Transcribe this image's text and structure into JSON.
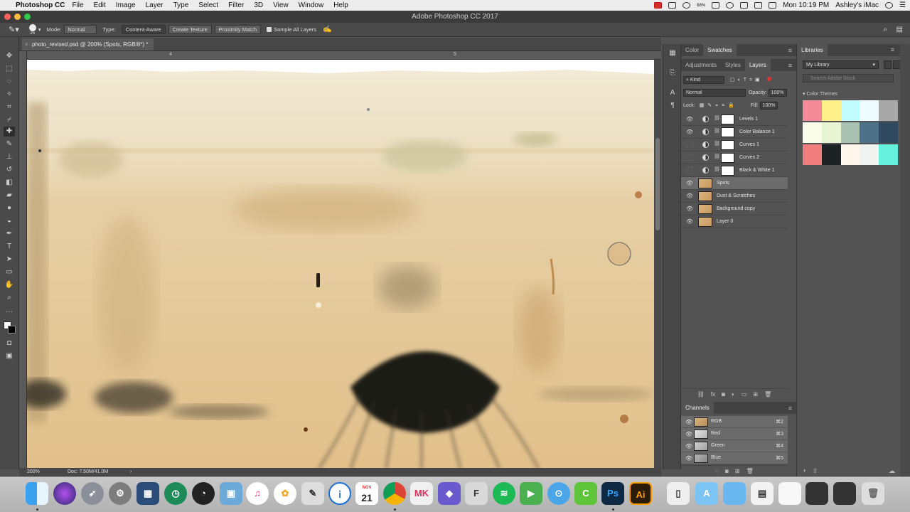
{
  "menubar": {
    "app_name": "Photoshop CC",
    "items": [
      "File",
      "Edit",
      "Image",
      "Layer",
      "Type",
      "Select",
      "Filter",
      "3D",
      "View",
      "Window",
      "Help"
    ],
    "battery_text": "68%",
    "clock": "Mon 10:19 PM",
    "user": "Ashley's iMac"
  },
  "window": {
    "title": "Adobe Photoshop CC 2017"
  },
  "options_bar": {
    "brush_size": "25",
    "mode_label": "Mode:",
    "mode_value": "Normal",
    "type_label": "Type:",
    "type_buttons": [
      "Content-Aware",
      "Create Texture",
      "Proximity Match"
    ],
    "sample_all_layers": "Sample All Layers"
  },
  "document": {
    "tab_title": "photo_revised.psd @ 200% (Spots, RGB/8*) *",
    "ruler_marks": [
      "4",
      "5"
    ],
    "zoom": "200%",
    "doc_size": "Doc: 7.50M/41.0M"
  },
  "panels": {
    "color_tabs": [
      "Color",
      "Swatches"
    ],
    "layer_tabs": [
      "Adjustments",
      "Styles",
      "Layers"
    ],
    "kind_filter": "Kind",
    "blend_mode": "Normal",
    "opacity_label": "Opacity:",
    "opacity_value": "100%",
    "lock_label": "Lock:",
    "fill_label": "Fill:",
    "fill_value": "100%",
    "layers": [
      {
        "name": "Levels 1",
        "type": "adjustment",
        "visible": true
      },
      {
        "name": "Color Balance 1",
        "type": "adjustment",
        "visible": true
      },
      {
        "name": "Curves 1",
        "type": "adjustment",
        "visible": false
      },
      {
        "name": "Curves 2",
        "type": "adjustment",
        "visible": false
      },
      {
        "name": "Black & White 1",
        "type": "adjustment",
        "visible": false
      },
      {
        "name": "Spots",
        "type": "pixel",
        "visible": true,
        "selected": true
      },
      {
        "name": "Dust & Scratches",
        "type": "pixel",
        "visible": true
      },
      {
        "name": "Background copy",
        "type": "pixel",
        "visible": true
      },
      {
        "name": "Layer 0",
        "type": "pixel",
        "visible": true
      }
    ],
    "channels_title": "Channels",
    "channels": [
      {
        "name": "RGB",
        "key": "⌘2"
      },
      {
        "name": "Red",
        "key": "⌘3"
      },
      {
        "name": "Green",
        "key": "⌘4"
      },
      {
        "name": "Blue",
        "key": "⌘5"
      }
    ]
  },
  "libraries": {
    "tab": "Libraries",
    "library_select": "My Library",
    "search_placeholder": "Search Adobe Stock",
    "section": "Color Themes",
    "themes": [
      [
        "#f58b98",
        "#fff08a",
        "#c2fbff",
        "#eefbff",
        "#a8a8a8"
      ],
      [
        "#fafcea",
        "#e9f5d2",
        "#a9c2b3",
        "#4b7088",
        "#2f4a60"
      ],
      [
        "#f07e7e",
        "#1d2324",
        "#fff7ec",
        "#f0f3f0",
        "#64f1de"
      ]
    ]
  },
  "dock": {
    "calendar_month": "NOV",
    "calendar_day": "21",
    "ps_label": "Ps",
    "ai_label": "Ai"
  }
}
